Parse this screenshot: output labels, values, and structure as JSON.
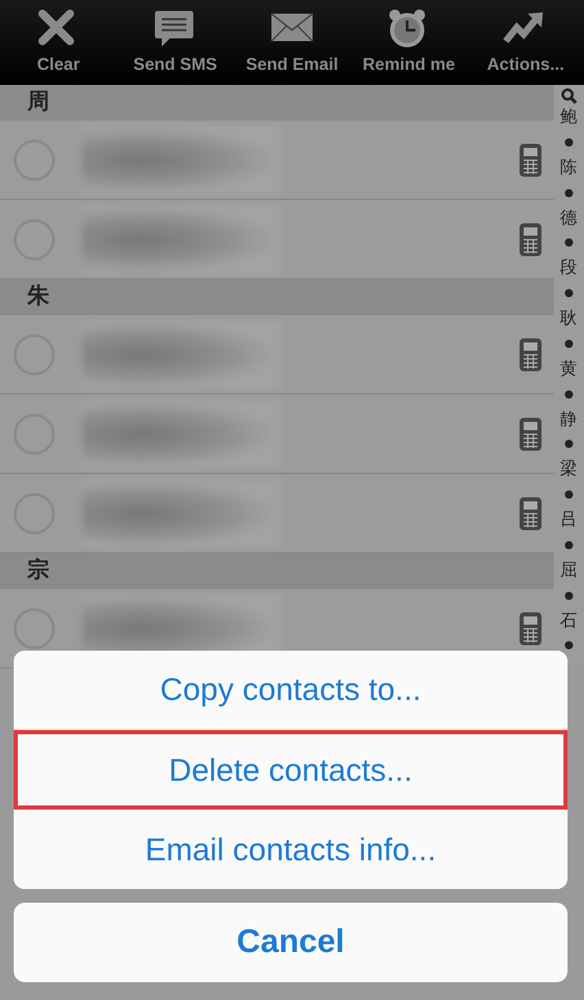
{
  "toolbar": [
    {
      "kind": "clear",
      "label": "Clear"
    },
    {
      "kind": "sms",
      "label": "Send SMS"
    },
    {
      "kind": "email",
      "label": "Send Email"
    },
    {
      "kind": "alarm",
      "label": "Remind me"
    },
    {
      "kind": "actions",
      "label": "Actions..."
    }
  ],
  "sections": [
    {
      "header": "周",
      "rows": [
        {
          "checked": false
        },
        {
          "checked": false
        }
      ]
    },
    {
      "header": "朱",
      "rows": [
        {
          "checked": false
        },
        {
          "checked": false
        },
        {
          "checked": false
        }
      ]
    },
    {
      "header": "宗",
      "rows": [
        {
          "checked": false
        }
      ]
    }
  ],
  "index": [
    "鲍",
    "陈",
    "德",
    "段",
    "耿",
    "黄",
    "静",
    "梁",
    "吕",
    "屈",
    "石"
  ],
  "action_sheet": {
    "options": [
      {
        "label": "Copy contacts to...",
        "highlighted": false
      },
      {
        "label": "Delete contacts...",
        "highlighted": true
      },
      {
        "label": "Email contacts info...",
        "highlighted": false
      }
    ],
    "cancel": "Cancel"
  }
}
